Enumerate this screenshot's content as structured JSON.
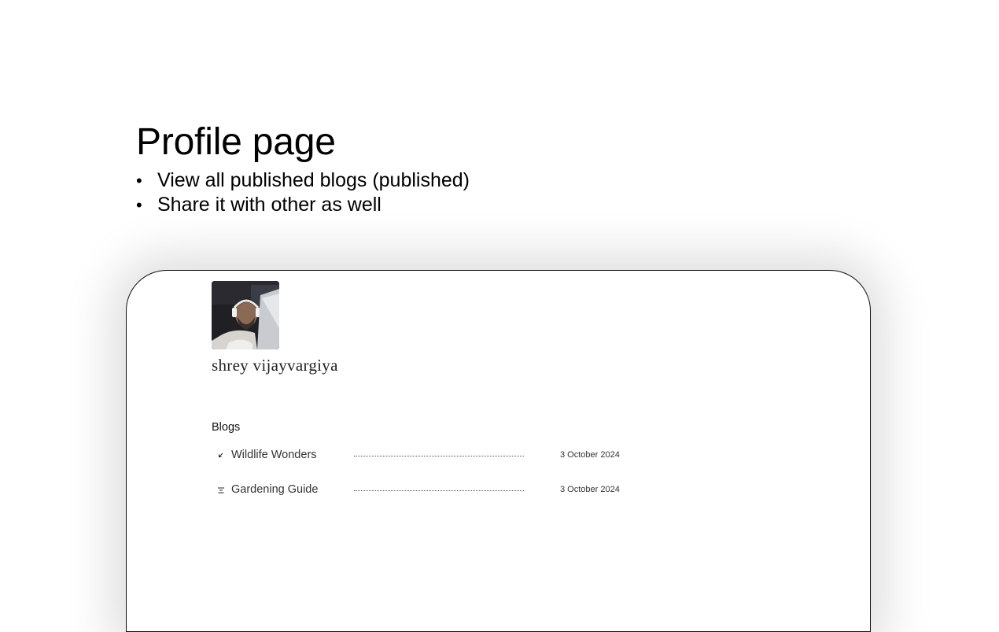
{
  "slide": {
    "title": "Profile page",
    "bullets": [
      "View all published blogs (published)",
      "Share it with other as well"
    ]
  },
  "profile": {
    "name": "shrey vijayvargiya"
  },
  "blogs": {
    "label": "Blogs",
    "items": [
      {
        "icon": "arrow-down-left-icon",
        "title": "Wildlife Wonders",
        "date": "3 October 2024"
      },
      {
        "icon": "text-align-center-icon",
        "title": "Gardening Guide",
        "date": "3 October 2024"
      }
    ]
  }
}
